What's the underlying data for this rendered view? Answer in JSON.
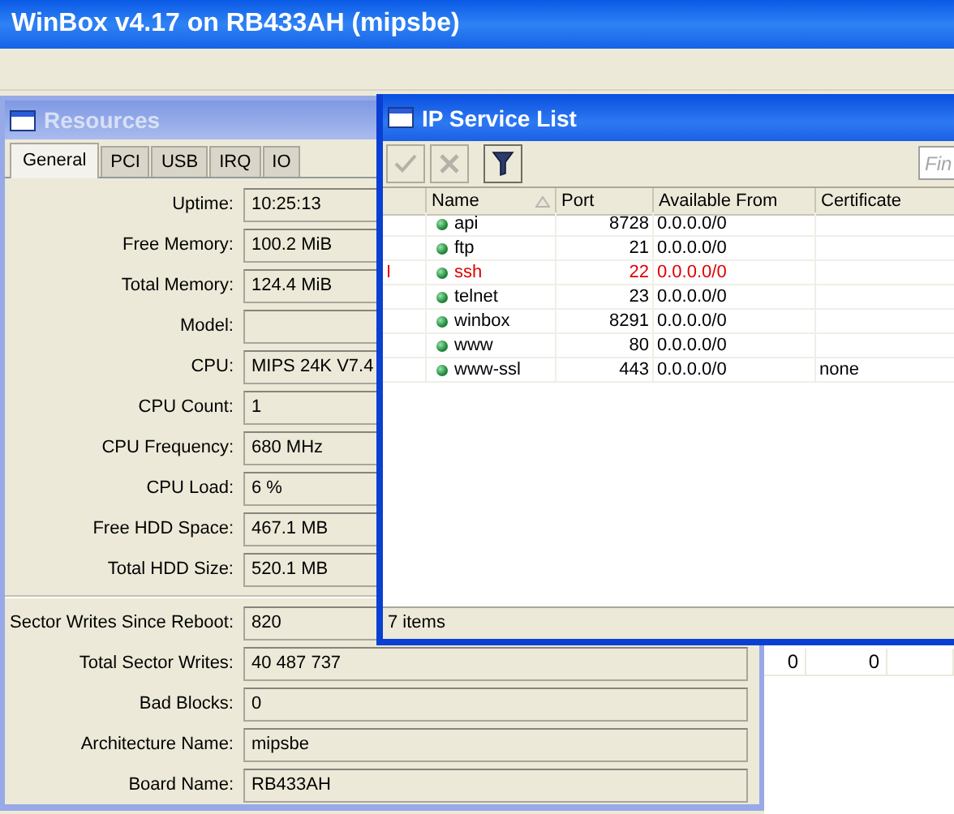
{
  "app": {
    "title": "WinBox v4.17 on RB433AH (mipsbe)"
  },
  "resources": {
    "title": "Resources",
    "active": false,
    "tabs": [
      {
        "label": "General",
        "selected": true
      },
      {
        "label": "PCI",
        "selected": false
      },
      {
        "label": "USB",
        "selected": false
      },
      {
        "label": "IRQ",
        "selected": false
      },
      {
        "label": "IO",
        "selected": false
      }
    ],
    "sections": [
      {
        "fields": [
          {
            "label": "Uptime:",
            "value": "10:25:13"
          },
          {
            "label": "Free Memory:",
            "value": "100.2 MiB"
          },
          {
            "label": "Total Memory:",
            "value": "124.4 MiB"
          },
          {
            "label": "Model:"
          },
          {
            "label": "CPU:",
            "value": "MIPS 24K V7.4"
          },
          {
            "label": "CPU Count:",
            "value": "1"
          },
          {
            "label": "CPU Frequency:",
            "value": "680 MHz"
          },
          {
            "label": "CPU Load:",
            "value": "6 %"
          },
          {
            "label": "Free HDD Space:",
            "value": "467.1 MB"
          },
          {
            "label": "Total HDD Size:",
            "value": "520.1 MB"
          }
        ]
      },
      {
        "fields": [
          {
            "label": "Sector Writes Since Reboot:",
            "value": "820"
          },
          {
            "label": "Total Sector Writes:",
            "value": "40 487 737"
          },
          {
            "label": "Bad Blocks:",
            "value": "0"
          },
          {
            "label": "Architecture Name:",
            "value": "mipsbe"
          },
          {
            "label": "Board Name:",
            "value": "RB433AH"
          }
        ]
      }
    ]
  },
  "ip_service_list": {
    "title": "IP Service List",
    "active": true,
    "toolbar": [
      {
        "kind": "enable",
        "disabled": true
      },
      {
        "kind": "disable",
        "disabled": true
      },
      {
        "kind": "filter",
        "disabled": false
      }
    ],
    "search": {
      "placeholder": "Fin"
    },
    "columns": [
      {
        "label": "Name",
        "sorted": true
      },
      {
        "label": "Port",
        "sorted": false
      },
      {
        "label": "Available From",
        "sorted": false
      },
      {
        "label": "Certificate",
        "sorted": false
      }
    ],
    "rows": [
      {
        "name": "api",
        "port": "8728",
        "available_from": "0.0.0.0/0",
        "invalid": false
      },
      {
        "name": "ftp",
        "port": "21",
        "available_from": "0.0.0.0/0",
        "invalid": false
      },
      {
        "flag": "I",
        "name": "ssh",
        "port": "22",
        "available_from": "0.0.0.0/0",
        "invalid": true
      },
      {
        "name": "telnet",
        "port": "23",
        "available_from": "0.0.0.0/0",
        "invalid": false
      },
      {
        "name": "winbox",
        "port": "8291",
        "available_from": "0.0.0.0/0",
        "invalid": false
      },
      {
        "name": "www",
        "port": "80",
        "available_from": "0.0.0.0/0",
        "invalid": false
      },
      {
        "name": "www-ssl",
        "port": "443",
        "available_from": "0.0.0.0/0",
        "certificate": "none",
        "invalid": false
      }
    ],
    "status": "7 items"
  },
  "background_table": {
    "rows": [
      {
        "column_1": "0",
        "column_2": "0"
      }
    ]
  }
}
